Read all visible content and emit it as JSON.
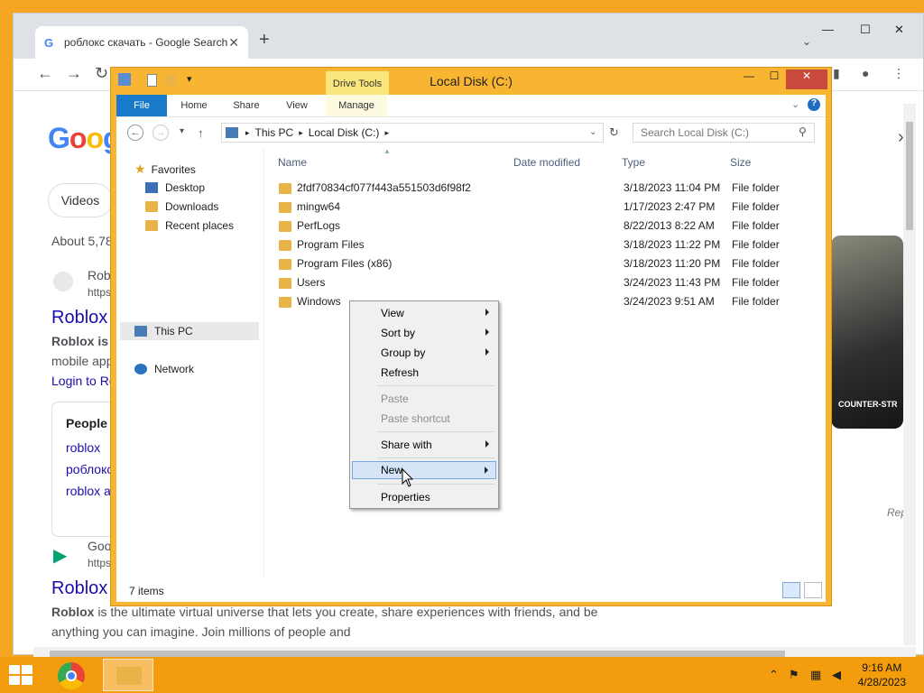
{
  "browser": {
    "tab_title": "роблокс скачать - Google Search",
    "new_tab": "+",
    "tab_search": "⌄",
    "minimize": "—",
    "maximize": "☐",
    "close": "✕",
    "back": "←",
    "forward": "→",
    "reload": "↻"
  },
  "google": {
    "logo_letters": [
      "G",
      "o",
      "o",
      "g"
    ],
    "chip_videos": "Videos",
    "results_count": "About 5,78",
    "result1_site": "Robl",
    "result1_url": "https",
    "result1_title": "Roblox",
    "result1_snippet_a": "Roblox is a",
    "result1_snippet_b": "mobile app",
    "result1_link": "Login to Ro",
    "people_also": "People a",
    "related": [
      "roblox",
      "роблокс",
      "roblox a"
    ],
    "result2_site": "Goo",
    "result2_url": "https",
    "result2_title": "Roblox",
    "result2_snippet_bold": "Roblox",
    "result2_snippet": " is the ultimate virtual universe that lets you create, share experiences with friends, and be",
    "result2_snippet2": "anything you can imagine. Join millions of people and",
    "game_label": "COUNTER-STR",
    "report": "Rep"
  },
  "explorer": {
    "title": "Local Disk (C:)",
    "contextual_tab": "Drive Tools",
    "ribbon_tabs": [
      "File",
      "Home",
      "Share",
      "View",
      "Manage"
    ],
    "breadcrumb": [
      "This PC",
      "Local Disk (C:)"
    ],
    "search_placeholder": "Search Local Disk (C:)",
    "nav": {
      "favorites": "Favorites",
      "desktop": "Desktop",
      "downloads": "Downloads",
      "recent": "Recent places",
      "thispc": "This PC",
      "network": "Network"
    },
    "columns": [
      "Name",
      "Date modified",
      "Type",
      "Size"
    ],
    "files": [
      {
        "name": "2fdf70834cf077f443a551503d6f98f2",
        "date": "3/18/2023 11:04 PM",
        "type": "File folder"
      },
      {
        "name": "mingw64",
        "date": "1/17/2023 2:47 PM",
        "type": "File folder"
      },
      {
        "name": "PerfLogs",
        "date": "8/22/2013 8:22 AM",
        "type": "File folder"
      },
      {
        "name": "Program Files",
        "date": "3/18/2023 11:22 PM",
        "type": "File folder"
      },
      {
        "name": "Program Files (x86)",
        "date": "3/18/2023 11:20 PM",
        "type": "File folder"
      },
      {
        "name": "Users",
        "date": "3/24/2023 11:43 PM",
        "type": "File folder"
      },
      {
        "name": "Windows",
        "date": "3/24/2023 9:51 AM",
        "type": "File folder"
      }
    ],
    "status": "7 items"
  },
  "context_menu": {
    "view": "View",
    "sort_by": "Sort by",
    "group_by": "Group by",
    "refresh": "Refresh",
    "paste": "Paste",
    "paste_shortcut": "Paste shortcut",
    "share_with": "Share with",
    "new": "New",
    "properties": "Properties"
  },
  "taskbar": {
    "time": "9:16 AM",
    "date": "4/28/2023"
  }
}
